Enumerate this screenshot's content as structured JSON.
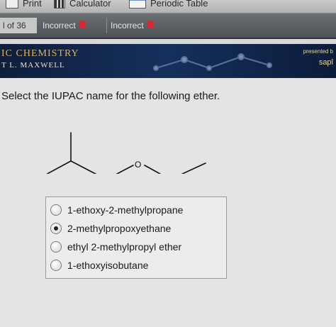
{
  "toolbar": {
    "print_label": "Print",
    "calculator_label": "Calculator",
    "periodic_label": "Periodic Table"
  },
  "question_nav": {
    "count_label": "l of 36",
    "tabs": [
      {
        "label": "Incorrect",
        "status": "incorrect"
      },
      {
        "label": "Incorrect",
        "status": "incorrect"
      }
    ]
  },
  "banner": {
    "title": "IC CHEMISTRY",
    "author": "T L. MAXWELL",
    "presented": "presented b",
    "publisher": "sapl"
  },
  "question": {
    "prompt": "Select the IUPAC name for the following ether.",
    "atom_label": "O"
  },
  "choices": [
    {
      "label": "1-ethoxy-2-methylpropane",
      "selected": false
    },
    {
      "label": "2-methylpropoxyethane",
      "selected": true
    },
    {
      "label": "ethyl 2-methylpropyl ether",
      "selected": false
    },
    {
      "label": "1-ethoxyisobutane",
      "selected": false
    }
  ],
  "colors": {
    "incorrect_mark": "#e0262a",
    "banner_bg": "#15305c",
    "banner_title": "#d8b45a"
  }
}
